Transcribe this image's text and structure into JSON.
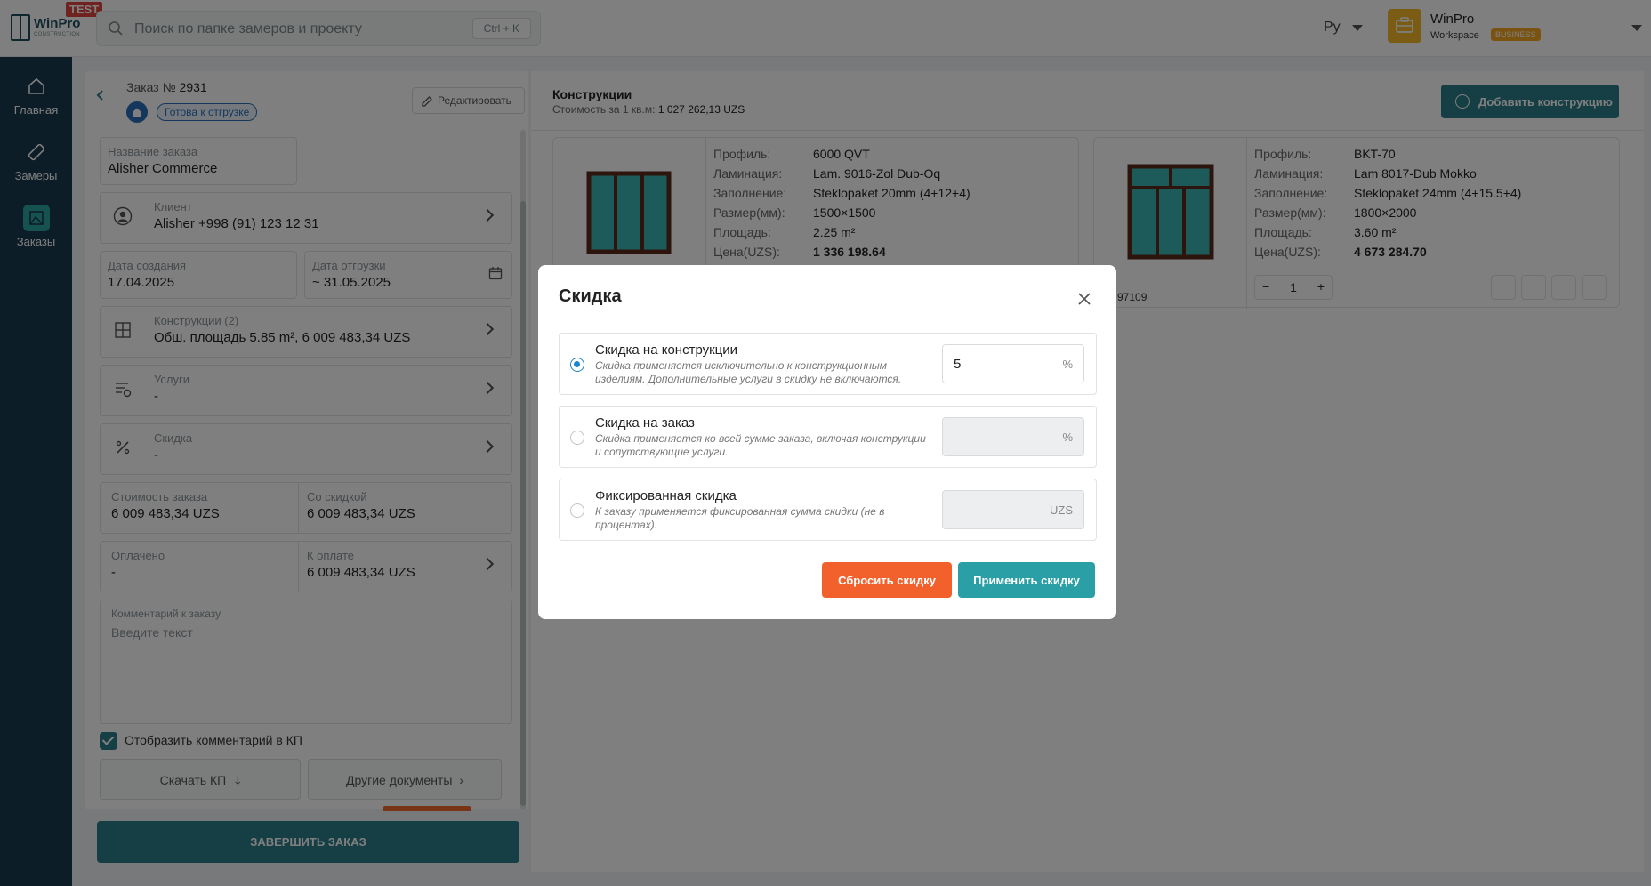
{
  "app": {
    "name": "WinPro",
    "tag": "TEST",
    "subtitle": "CONSTRUCTION"
  },
  "search": {
    "placeholder": "Поиск по папке замеров и проекту",
    "shortcut": "Ctrl + K"
  },
  "lang": "Ру",
  "workspace": {
    "name": "WinPro",
    "label": "Workspace",
    "plan": "BUSINESS"
  },
  "sidebar": {
    "items": [
      {
        "label": "Главная",
        "icon": "home-icon"
      },
      {
        "label": "Замеры",
        "icon": "ruler-icon"
      },
      {
        "label": "Заказы",
        "icon": "orders-icon",
        "active": true
      }
    ]
  },
  "order": {
    "number_label": "Заказ №",
    "number": "2931",
    "status": "Готова к отгрузке",
    "edit_label": "Редактировать",
    "name_label": "Название заказа",
    "name": "Alisher Commerce",
    "client_label": "Клиент",
    "client": "Alisher +998 (91) 123 12 31",
    "created_label": "Дата создания",
    "created": "17.04.2025",
    "ship_label": "Дата отгрузки",
    "ship": "~ 31.05.2025",
    "constr_label": "Конструкции (2)",
    "constr": "Обш. площадь 5.85 m²,  6 009 483,34 UZS",
    "services_label": "Услуги",
    "services": "-",
    "discount_label": "Скидка",
    "discount": "-",
    "cost_label": "Стоимость заказа",
    "cost": "6 009 483,34 UZS",
    "with_disc_label": "Со скидкой",
    "with_disc": "6 009 483,34 UZS",
    "paid_label": "Оплачено",
    "paid": "-",
    "to_pay_label": "К оплате",
    "to_pay": "6 009 483,34 UZS",
    "comment_label": "Комментарий к заказу",
    "comment_placeholder": "Введите текст",
    "show_comment": "Отобразить комментарий в КП",
    "download_kp": "Скачать КП",
    "other_docs": "Другие документы",
    "finish": "ЗАВЕРШИТЬ ЗАКАЗ"
  },
  "constructions": {
    "title": "Конструкции",
    "price_label": "Стоимость за 1 кв.м:",
    "price": "1 027 262,13 UZS",
    "add_label": "Добавить конструкцию",
    "keys": [
      "Профиль:",
      "Ламинация:",
      "Заполнение:",
      "Размер(мм):",
      "Площадь:",
      "Цена(UZS):"
    ],
    "cards": [
      {
        "values": [
          "6000 QVT",
          "Lam. 9016-Zol Dub-Oq",
          "Steklopaket 20mm (4+12+4)",
          "1500×1500",
          "2.25 m²",
          "1 336 198.64"
        ]
      },
      {
        "values": [
          "BKT-70",
          "Lam 8017-Dub Mokko",
          "Steklopaket 24mm (4+15.5+4)",
          "1800×2000",
          "3.60 m²",
          "4 673 284.70"
        ],
        "code": "97109",
        "qty": "1"
      }
    ]
  },
  "modal": {
    "title": "Скидка",
    "options": [
      {
        "title": "Скидка на конструкции",
        "desc": "Скидка применяется исключительно к конструкционным изделиям. Дополнительные услуги в скидку не включаются.",
        "value": "5",
        "unit": "%",
        "selected": true
      },
      {
        "title": "Скидка на заказ",
        "desc": "Скидка применяется ко всей сумме заказа, включая конструкции и сопутствующие услуги.",
        "value": "",
        "unit": "%",
        "selected": false
      },
      {
        "title": "Фиксированная скидка",
        "desc": "К заказу применяется фиксированная сумма скидки (не в процентах).",
        "value": "",
        "unit": "UZS",
        "selected": false
      }
    ],
    "reset": "Сбросить скидку",
    "apply": "Применить скидку"
  },
  "colors": {
    "accent": "#2a7f8a",
    "sidebar": "#1b3a50",
    "reset": "#f2612c",
    "apply": "#2a9fa6",
    "glass": "#3bb7b4",
    "frame": "#5a2a1c"
  }
}
